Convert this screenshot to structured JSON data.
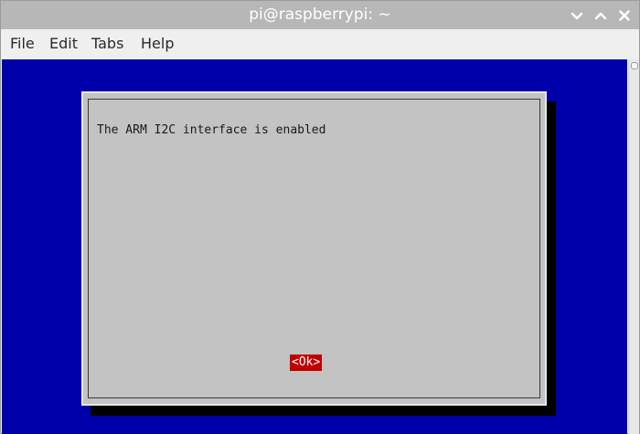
{
  "window": {
    "title": "pi@raspberrypi: ~",
    "controls": [
      "minimize",
      "maximize",
      "close"
    ]
  },
  "menubar": {
    "items": [
      "File",
      "Edit",
      "Tabs",
      "Help"
    ]
  },
  "terminal": {
    "background": "#0000aa",
    "dialog": {
      "message": "The ARM I2C interface is enabled",
      "ok_label": "<Ok>",
      "ok_color": "#c00000",
      "dialog_color": "#c3c3c3"
    }
  }
}
